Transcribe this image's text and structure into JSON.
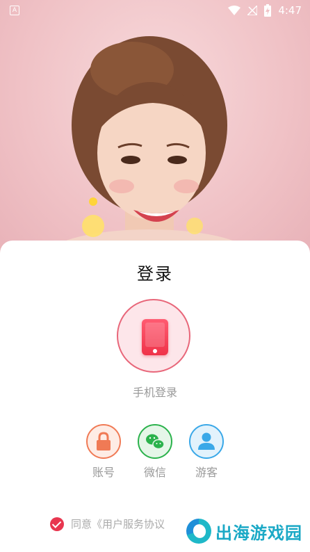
{
  "status_bar": {
    "time": "4:47"
  },
  "login": {
    "title": "登录",
    "phone_label": "手机登录",
    "options": [
      {
        "label": "账号",
        "icon": "lock-icon",
        "color": "#f07a55"
      },
      {
        "label": "微信",
        "icon": "wechat-icon",
        "color": "#2bb24c"
      },
      {
        "label": "游客",
        "icon": "user-icon",
        "color": "#3aa8e8"
      }
    ],
    "agreement_text": "同意《用户服务协议",
    "agreement_checked": true,
    "accent": "#e8364f"
  },
  "watermark": {
    "text": "出海游戏园"
  }
}
